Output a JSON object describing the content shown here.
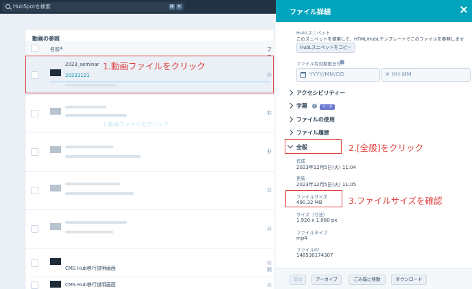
{
  "topbar": {
    "search_placeholder": "HubSpotを検索",
    "kbd1": "⌘",
    "kbd2": "K"
  },
  "browse": {
    "title": "動画の参照",
    "columns": {
      "name": "名前",
      "file": "ファ"
    },
    "rows": [
      {
        "name": "2023_seminar",
        "link": "20231121",
        "public": "公"
      },
      {
        "name": "",
        "link": "",
        "public": "非"
      },
      {
        "name": "",
        "link": "",
        "public": "非"
      },
      {
        "name": "",
        "link": "",
        "public": "公"
      },
      {
        "name": "",
        "link": "",
        "public": "公"
      },
      {
        "name": "CMS Hub移行説明画面",
        "link": "",
        "public": "公開"
      },
      {
        "name": "CMS Hub移行説明画面",
        "link": "",
        "public": "公開"
      }
    ]
  },
  "panel": {
    "title": "ファイル詳細",
    "hubl_label": "HubLスニペット",
    "hubl_desc": "このスニペットを使用して、HTML/HubLテンプレートでこのファイルを参照します",
    "hubl_copy": "HubLスニペットをコピー",
    "expiry_label": "ファイル有効期限日付",
    "date_placeholder": "YYYY/MM/DD",
    "time_placeholder": "HH:MM",
    "sections": {
      "accessibility": "アクセシビリティー",
      "captions": "字幕",
      "beta": "ベータ",
      "usage": "ファイルの使用",
      "history": "ファイル履歴",
      "general": "全般"
    },
    "general": {
      "created_label": "作成",
      "created_value": "2023年12月5日(火) 11:04",
      "updated_label": "更新",
      "updated_value": "2023年12月5日(火) 11:05",
      "size_label": "ファイルサイズ",
      "size_value": "490.32 MB",
      "dims_label": "サイズ（寸法）",
      "dims_value": "1,920 x 1,080 px",
      "type_label": "ファイルタイプ",
      "type_value": "mp4",
      "id_label": "ファイルID",
      "id_value": "148530174307"
    },
    "footer": {
      "replace": "置換",
      "archive": "アーカイブ",
      "trash": "ごみ箱に移動",
      "download": "ダウンロード"
    }
  },
  "annotations": {
    "step1": "1.動画ファイルをクリック",
    "step2": "2.[全般]をクリック",
    "step3": "3.ファイルサイズを確認",
    "ghost": "1.動画ファイルをクリック"
  },
  "colors": {
    "accent": "#00a4bd",
    "annotation": "#e0403d",
    "topbar": "#213343"
  }
}
